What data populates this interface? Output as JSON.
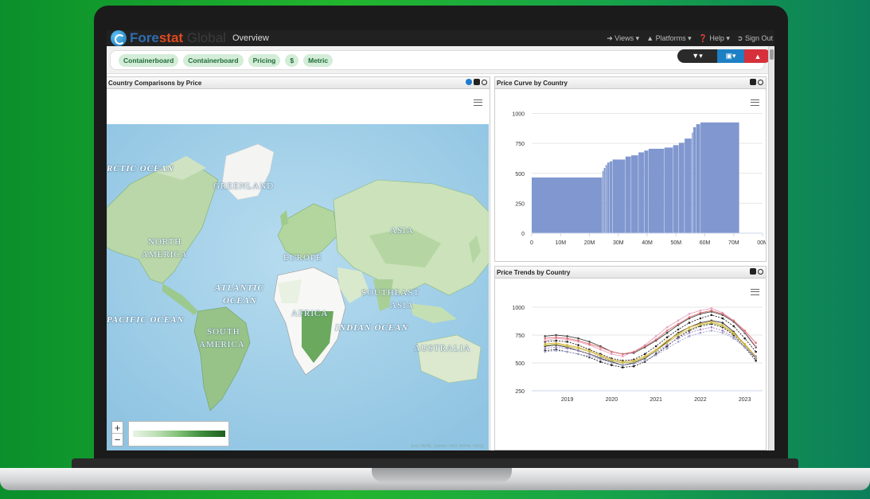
{
  "app": {
    "logo_part1": "Fore",
    "logo_part2": "stat",
    "logo_part3": " Global",
    "page": "Overview"
  },
  "nav": {
    "views": "Views",
    "platforms": "Platforms",
    "help": "Help",
    "signout": "Sign Out"
  },
  "filters": [
    "Containerboard",
    "Containerboard",
    "Pricing",
    "$",
    "Metric"
  ],
  "panels": {
    "map_title": "Country Comparisons by Price",
    "curve_title": "Price Curve by Country",
    "trends_title": "Price Trends by Country"
  },
  "map": {
    "labels": {
      "arctic": "RCTIC OCEAN",
      "greenland": "GREENLAND",
      "north_america_1": "NORTH",
      "north_america_2": "AMERICA",
      "europe": "EUROPE",
      "asia": "ASIA",
      "atlantic_1": "ATLANTIC",
      "atlantic_2": "OCEAN",
      "pacific": "PACIFIC OCEAN",
      "africa": "AFRICA",
      "indian": "INDIAN OCEAN",
      "southeast_asia_1": "SOUTHEAST",
      "southeast_asia_2": "ASIA",
      "south_america_1": "SOUTH",
      "south_america_2": "AMERICA",
      "australia": "AUSTRALIA"
    },
    "zoom_in": "+",
    "zoom_out": "−",
    "attribution": "Esri, HERE, Garmin, FAO, NOAA, USGS"
  },
  "colors": {
    "accent_green": "#1e6b35",
    "bar_fill": "#8097cf",
    "brand_blue": "#2f6db0",
    "save_blue": "#1d7fc4",
    "clear_red": "#d6303b"
  },
  "chart_data": [
    {
      "type": "bar",
      "title": "",
      "xlabel": "",
      "ylabel": "",
      "xlim": [
        0,
        80
      ],
      "ylim": [
        0,
        1050
      ],
      "x_tick_labels": [
        "0",
        "10M",
        "20M",
        "30M",
        "40M",
        "50M",
        "60M",
        "70M",
        "00M"
      ],
      "y_tick_labels": [
        "0",
        "250",
        "500",
        "750",
        "1000"
      ],
      "bars": [
        {
          "x0": 0,
          "x1": 24.5,
          "value": 465
        },
        {
          "x0": 24.5,
          "x1": 25,
          "value": 520
        },
        {
          "x0": 25,
          "x1": 25.6,
          "value": 545
        },
        {
          "x0": 25.6,
          "x1": 26.2,
          "value": 570
        },
        {
          "x0": 26.2,
          "x1": 27,
          "value": 590
        },
        {
          "x0": 27,
          "x1": 28,
          "value": 600
        },
        {
          "x0": 28,
          "x1": 32.5,
          "value": 615
        },
        {
          "x0": 32.5,
          "x1": 34.5,
          "value": 640
        },
        {
          "x0": 34.5,
          "x1": 37,
          "value": 650
        },
        {
          "x0": 37,
          "x1": 39,
          "value": 675
        },
        {
          "x0": 39,
          "x1": 40.5,
          "value": 690
        },
        {
          "x0": 40.5,
          "x1": 46,
          "value": 705
        },
        {
          "x0": 46,
          "x1": 49,
          "value": 715
        },
        {
          "x0": 49,
          "x1": 51,
          "value": 735
        },
        {
          "x0": 51,
          "x1": 53,
          "value": 755
        },
        {
          "x0": 53,
          "x1": 55.5,
          "value": 790
        },
        {
          "x0": 55.5,
          "x1": 56,
          "value": 840
        },
        {
          "x0": 56,
          "x1": 57,
          "value": 885
        },
        {
          "x0": 57,
          "x1": 58.5,
          "value": 910
        },
        {
          "x0": 58.5,
          "x1": 72,
          "value": 925
        }
      ]
    },
    {
      "type": "line",
      "title": "",
      "xlabel": "",
      "ylabel": "",
      "xlim": [
        2018.2,
        2023.4
      ],
      "ylim": [
        250,
        1050
      ],
      "x_tick_labels": [
        "2019",
        "2020",
        "2021",
        "2022",
        "2023"
      ],
      "y_tick_labels": [
        "250",
        "500",
        "750",
        "1000"
      ],
      "x": [
        2018.5,
        2018.75,
        2019.0,
        2019.25,
        2019.5,
        2019.75,
        2020.0,
        2020.25,
        2020.5,
        2020.75,
        2021.0,
        2021.25,
        2021.5,
        2021.75,
        2022.0,
        2022.25,
        2022.5,
        2022.75,
        2023.0,
        2023.25
      ],
      "series": [
        {
          "color": "#222222",
          "values": [
            690,
            700,
            690,
            660,
            620,
            580,
            540,
            520,
            530,
            580,
            650,
            730,
            800,
            860,
            900,
            930,
            900,
            830,
            720,
            600
          ]
        },
        {
          "color": "#333333",
          "values": [
            650,
            660,
            640,
            610,
            580,
            540,
            510,
            480,
            500,
            540,
            610,
            690,
            770,
            820,
            860,
            880,
            860,
            780,
            660,
            540
          ]
        },
        {
          "color": "#444444",
          "values": [
            740,
            750,
            740,
            720,
            690,
            650,
            600,
            580,
            590,
            640,
            700,
            770,
            840,
            900,
            940,
            960,
            930,
            870,
            770,
            640
          ]
        },
        {
          "color": "#222222",
          "values": [
            610,
            620,
            600,
            580,
            550,
            510,
            480,
            460,
            470,
            510,
            580,
            650,
            730,
            790,
            830,
            850,
            820,
            750,
            640,
            520
          ]
        },
        {
          "color": "#e8a0c0",
          "values": [
            700,
            720,
            710,
            690,
            660,
            620,
            580,
            560,
            600,
            660,
            740,
            820,
            880,
            940,
            970,
            990,
            950,
            880,
            780,
            650
          ]
        },
        {
          "color": "#e0b040",
          "values": [
            670,
            680,
            660,
            640,
            610,
            570,
            530,
            510,
            520,
            560,
            620,
            700,
            760,
            820,
            850,
            870,
            840,
            770,
            670,
            560
          ]
        },
        {
          "color": "#9a7cc0",
          "values": [
            630,
            640,
            630,
            610,
            580,
            550,
            520,
            500,
            510,
            550,
            600,
            660,
            720,
            770,
            800,
            820,
            790,
            730,
            640,
            540
          ]
        },
        {
          "color": "#e07070",
          "values": [
            720,
            730,
            720,
            700,
            670,
            640,
            600,
            580,
            600,
            650,
            710,
            790,
            850,
            910,
            950,
            970,
            940,
            880,
            790,
            680
          ]
        },
        {
          "color": "#c0c040",
          "values": [
            660,
            670,
            650,
            630,
            600,
            560,
            520,
            500,
            510,
            550,
            610,
            680,
            750,
            800,
            840,
            860,
            830,
            760,
            660,
            550
          ]
        },
        {
          "color": "#a0a0d0",
          "values": [
            600,
            610,
            600,
            580,
            560,
            530,
            500,
            480,
            490,
            520,
            570,
            630,
            690,
            740,
            770,
            790,
            770,
            720,
            640,
            560
          ]
        }
      ]
    }
  ]
}
